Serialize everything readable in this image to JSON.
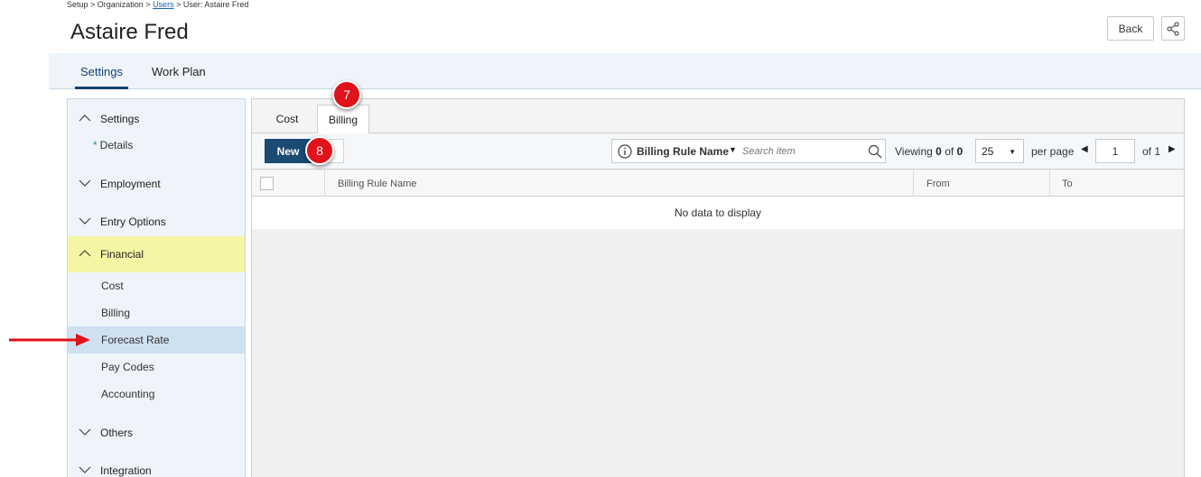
{
  "breadcrumb": {
    "part1": "Setup > Organization > ",
    "link": "Users",
    "part2": " > User: Astaire Fred"
  },
  "page_title": "Astaire Fred",
  "header": {
    "back_label": "Back",
    "share_icon": "share-icon"
  },
  "top_tabs": {
    "settings": "Settings",
    "work_plan": "Work Plan"
  },
  "sidebar": {
    "settings": "Settings",
    "details": "Details",
    "employment": "Employment",
    "entry_options": "Entry Options",
    "financial": "Financial",
    "cost": "Cost",
    "billing": "Billing",
    "forecast_rate": "Forecast Rate",
    "pay_codes": "Pay Codes",
    "accounting": "Accounting",
    "others": "Others",
    "integration": "Integration"
  },
  "sub_tabs": {
    "cost": "Cost",
    "billing": "Billing"
  },
  "toolbar": {
    "new_label": "New",
    "search_field": "Billing Rule Name",
    "search_placeholder": "Search item",
    "viewing_prefix": "Viewing",
    "viewing_start": "0",
    "viewing_of": "of",
    "viewing_total": "0",
    "page_size": "25",
    "per_page": "per page",
    "current_page": "1",
    "of_pages": "of 1"
  },
  "grid": {
    "columns": [
      "Billing Rule Name",
      "From",
      "To"
    ],
    "empty_message": "No data to display"
  },
  "callouts": {
    "billing_tab": "7",
    "new_button": "8"
  },
  "colors": {
    "accent": "#15416e",
    "callout": "#e0121a",
    "highlight": "#f5f6a4",
    "selected": "#cfe0f1"
  }
}
